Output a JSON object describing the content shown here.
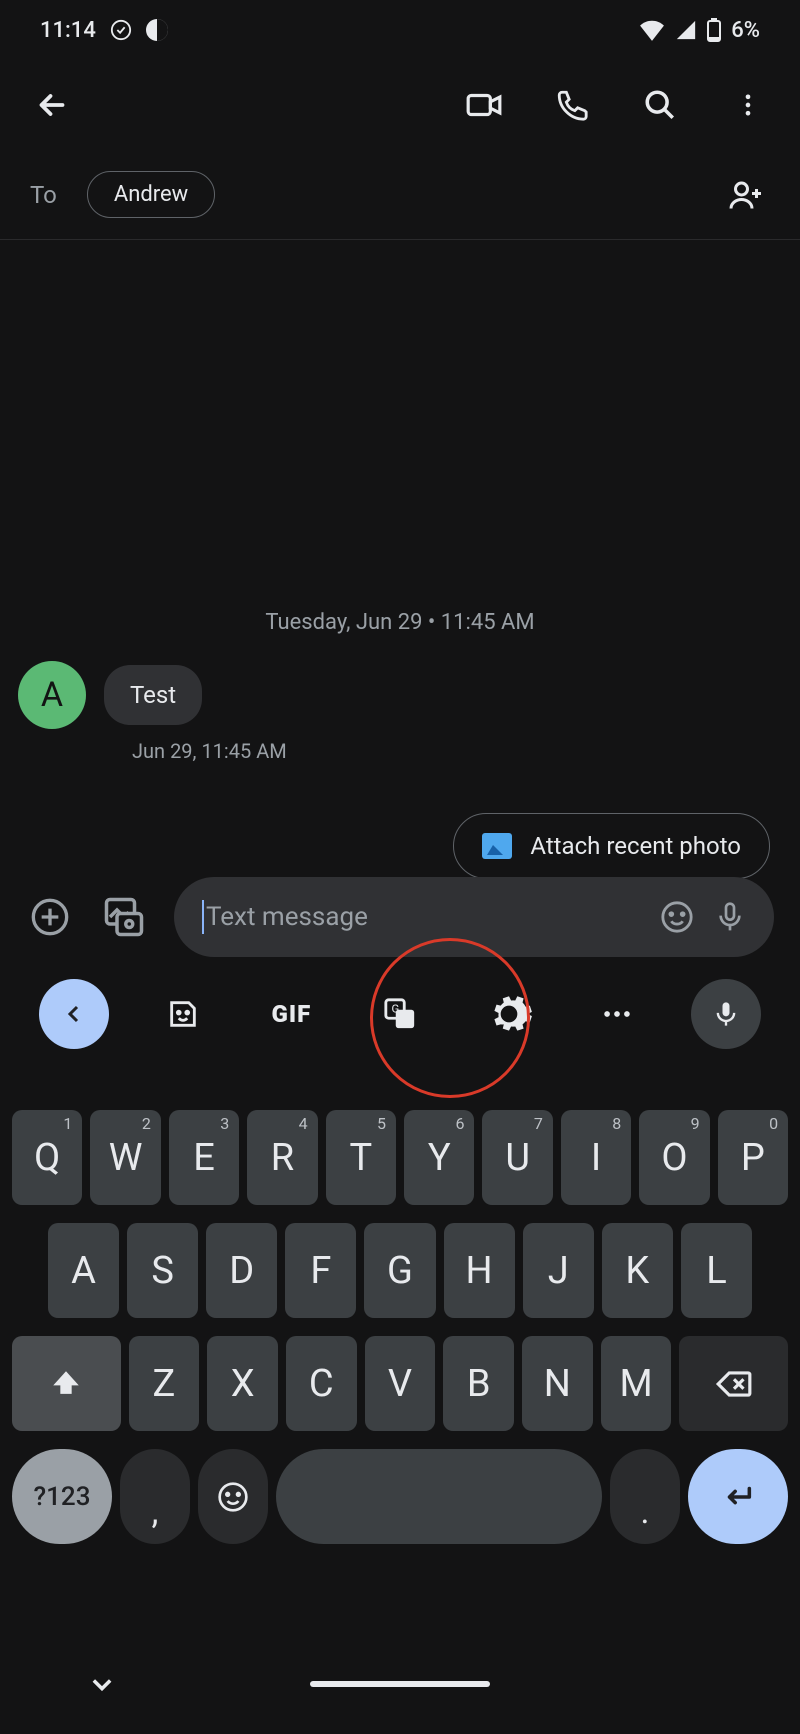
{
  "statusbar": {
    "time": "11:14",
    "battery": "6%"
  },
  "to": {
    "label": "To",
    "recipient": "Andrew"
  },
  "conversation": {
    "dateline": "Tuesday, Jun 29 • 11:45 AM",
    "avatar_letter": "A",
    "message": "Test",
    "meta": "Jun 29, 11:45 AM",
    "suggestion": "Attach recent photo"
  },
  "compose": {
    "placeholder": "Text message"
  },
  "kbd_suggest": {
    "gif": "GIF"
  },
  "keyboard": {
    "row1": [
      {
        "k": "Q",
        "s": "1"
      },
      {
        "k": "W",
        "s": "2"
      },
      {
        "k": "E",
        "s": "3"
      },
      {
        "k": "R",
        "s": "4"
      },
      {
        "k": "T",
        "s": "5"
      },
      {
        "k": "Y",
        "s": "6"
      },
      {
        "k": "U",
        "s": "7"
      },
      {
        "k": "I",
        "s": "8"
      },
      {
        "k": "O",
        "s": "9"
      },
      {
        "k": "P",
        "s": "0"
      }
    ],
    "row2": [
      "A",
      "S",
      "D",
      "F",
      "G",
      "H",
      "J",
      "K",
      "L"
    ],
    "row3": [
      "Z",
      "X",
      "C",
      "V",
      "B",
      "N",
      "M"
    ],
    "sym": "?123",
    "comma": ",",
    "dot": "."
  }
}
